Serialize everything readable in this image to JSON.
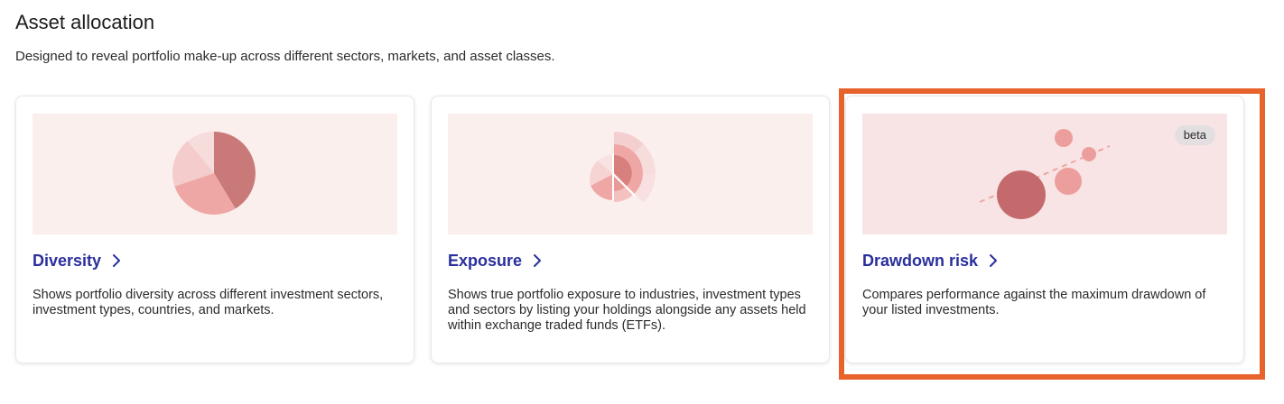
{
  "section": {
    "title": "Asset allocation",
    "subtitle": "Designed to reveal portfolio make-up across different sectors, markets, and asset classes."
  },
  "cards": [
    {
      "link_label": "Diversity",
      "description": "Shows portfolio diversity across different investment sectors, investment types, countries, and markets."
    },
    {
      "link_label": "Exposure",
      "description": "Shows true portfolio exposure to industries, investment types and sectors by listing your holdings alongside any assets held within exchange traded funds (ETFs)."
    },
    {
      "link_label": "Drawdown risk",
      "description": "Compares performance against the maximum drawdown of your listed investments.",
      "badge": "beta"
    }
  ],
  "colors": {
    "link": "#2a2f9e",
    "highlight": "#e8632c",
    "illustration_bg": "#fbefee"
  }
}
